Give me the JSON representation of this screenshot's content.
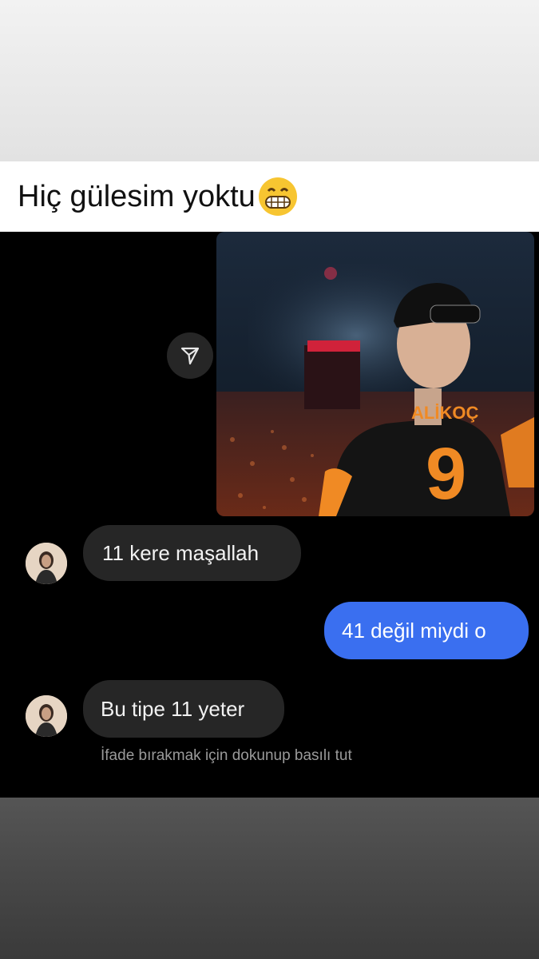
{
  "caption": {
    "text": "Hiç gülesim yoktu",
    "emoji": "grinning-face-emoji"
  },
  "shared_post": {
    "icon": "send-arrow-icon",
    "jersey_text": "ALİKOÇ",
    "jersey_number": "9"
  },
  "messages": [
    {
      "direction": "incoming",
      "text": "11 kere maşallah"
    },
    {
      "direction": "outgoing",
      "text": "41 değil miydi o"
    },
    {
      "direction": "incoming",
      "text": "Bu tipe 11 yeter"
    }
  ],
  "hint": "İfade bırakmak için dokunup basılı tut",
  "colors": {
    "chat_background": "#000000",
    "incoming_bubble": "#262626",
    "outgoing_bubble": "#3a6ff0",
    "jersey_orange": "#f08a24"
  }
}
